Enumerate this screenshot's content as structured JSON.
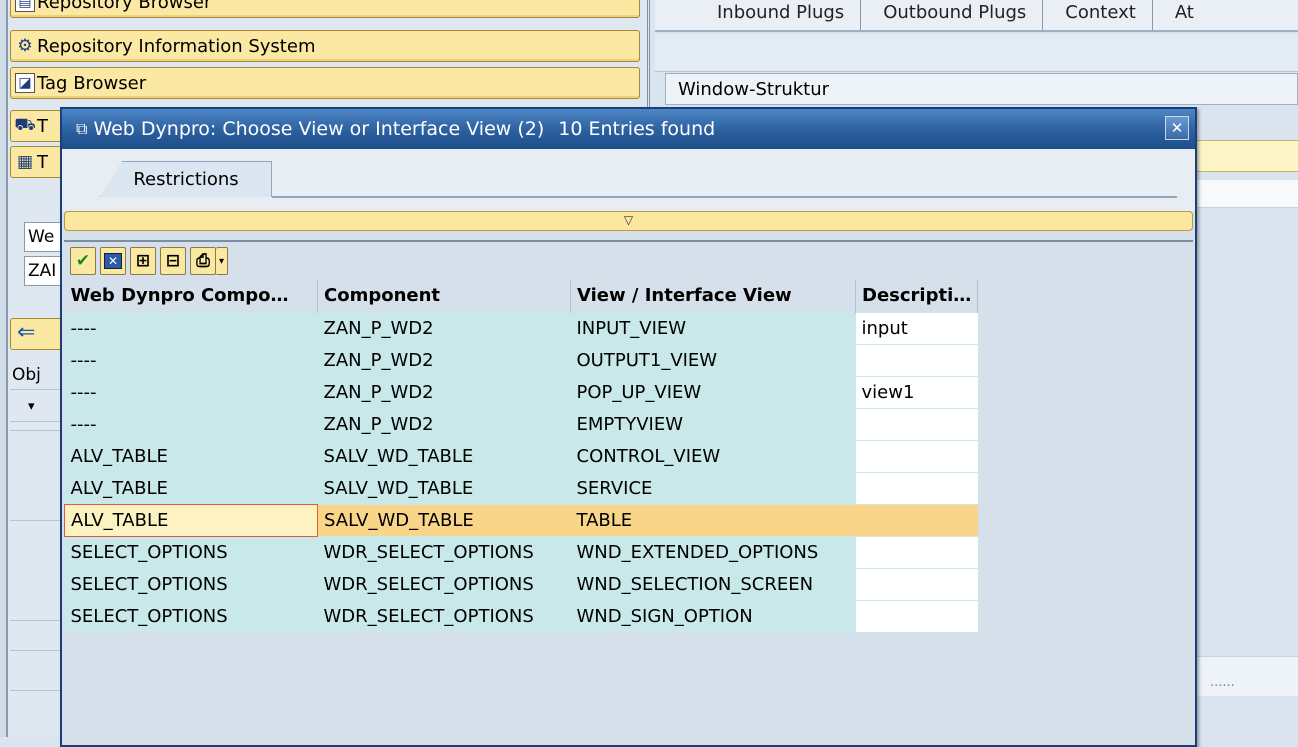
{
  "background": {
    "object_buttons": [
      {
        "label": "Repository Browser",
        "icon": "repository-browser-icon"
      },
      {
        "label": "Repository Information System",
        "icon": "info-system-icon"
      },
      {
        "label": "Tag Browser",
        "icon": "tag-browser-icon"
      }
    ],
    "partial_buttons": [
      {
        "label": "T",
        "icon": "transport-icon"
      },
      {
        "label": "T",
        "icon": "template-icon"
      }
    ],
    "inputs": [
      "We",
      "ZAI"
    ],
    "object_list_header": "Obj",
    "tabs": [
      "Inbound Plugs",
      "Outbound Plugs",
      "Context",
      "At"
    ],
    "window_structure_label": "Window-Struktur",
    "right_lower_text": "......"
  },
  "dialog": {
    "title": "Web Dynpro: Choose View or Interface View (2)",
    "entries": "10 Entries found",
    "close_label": "✕",
    "restrictions_tab": "Restrictions",
    "collapse_symbol": "▽",
    "toolbar": [
      "ok-icon",
      "cancel-icon",
      "find-icon",
      "find-next-icon",
      "print-icon"
    ],
    "columns": [
      "Web Dynpro Compo",
      "Component",
      "View / Interface View",
      "Descripti"
    ],
    "rows": [
      {
        "wd": "----",
        "comp": "ZAN_P_WD2",
        "view": "INPUT_VIEW",
        "desc": "input"
      },
      {
        "wd": "----",
        "comp": "ZAN_P_WD2",
        "view": "OUTPUT1_VIEW",
        "desc": ""
      },
      {
        "wd": "----",
        "comp": "ZAN_P_WD2",
        "view": "POP_UP_VIEW",
        "desc": "view1"
      },
      {
        "wd": "----",
        "comp": "ZAN_P_WD2",
        "view": "EMPTYVIEW",
        "desc": ""
      },
      {
        "wd": "ALV_TABLE",
        "comp": "SALV_WD_TABLE",
        "view": "CONTROL_VIEW",
        "desc": ""
      },
      {
        "wd": "ALV_TABLE",
        "comp": "SALV_WD_TABLE",
        "view": "SERVICE",
        "desc": ""
      },
      {
        "wd": "ALV_TABLE",
        "comp": "SALV_WD_TABLE",
        "view": "TABLE",
        "desc": "",
        "selected": true
      },
      {
        "wd": "SELECT_OPTIONS",
        "comp": "WDR_SELECT_OPTIONS",
        "view": "WND_EXTENDED_OPTIONS",
        "desc": ""
      },
      {
        "wd": "SELECT_OPTIONS",
        "comp": "WDR_SELECT_OPTIONS",
        "view": "WND_SELECTION_SCREEN",
        "desc": ""
      },
      {
        "wd": "SELECT_OPTIONS",
        "comp": "WDR_SELECT_OPTIONS",
        "view": "WND_SIGN_OPTION",
        "desc": ""
      }
    ]
  }
}
